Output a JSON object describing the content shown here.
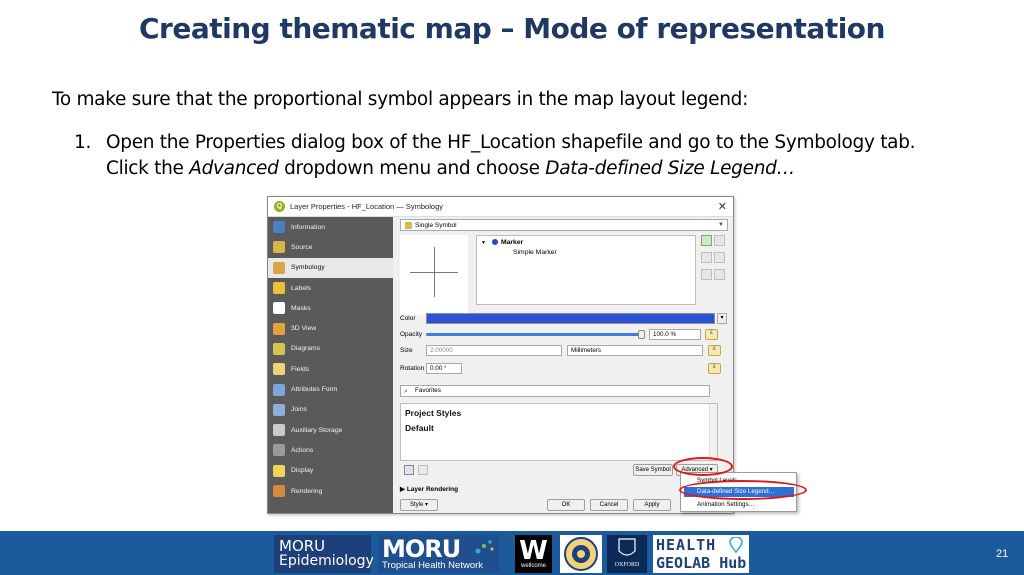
{
  "slide": {
    "title": "Creating thematic map – Mode of representation",
    "intro": "To make sure that the proportional symbol appears in the map layout legend:",
    "step_number": "1.",
    "step_line1": "Open the Properties dialog box of the HF_Location shapefile and go to the Symbology tab.",
    "step_line2_pre": "Click the ",
    "step_line2_em1": "Advanced",
    "step_line2_mid": " dropdown menu and choose ",
    "step_line2_em2": "Data-defined Size Legend…",
    "page_number": "21"
  },
  "dialog": {
    "title": "Layer Properties - HF_Location — Symbology",
    "close": "✕",
    "sidebar": [
      {
        "label": "Information",
        "color": "#4a7fc1",
        "icon": "info-icon"
      },
      {
        "label": "Source",
        "color": "#d8b44a",
        "icon": "source-icon"
      },
      {
        "label": "Symbology",
        "color": "#d9a54a",
        "icon": "paintbrush-icon"
      },
      {
        "label": "Labels",
        "color": "#e9c23a",
        "icon": "labels-icon"
      },
      {
        "label": "Masks",
        "color": "#ffffff",
        "icon": "masks-icon"
      },
      {
        "label": "3D View",
        "color": "#e2a13b",
        "icon": "cube-icon"
      },
      {
        "label": "Diagrams",
        "color": "#d6c24e",
        "icon": "diagrams-icon"
      },
      {
        "label": "Fields",
        "color": "#e8d27a",
        "icon": "fields-icon"
      },
      {
        "label": "Attributes Form",
        "color": "#7fa6d9",
        "icon": "form-icon"
      },
      {
        "label": "Joins",
        "color": "#8ab0d9",
        "icon": "joins-icon"
      },
      {
        "label": "Auxiliary Storage",
        "color": "#cbcbcb",
        "icon": "storage-icon"
      },
      {
        "label": "Actions",
        "color": "#9a9a9a",
        "icon": "gear-icon"
      },
      {
        "label": "Display",
        "color": "#f0d35a",
        "icon": "display-icon"
      },
      {
        "label": "Rendering",
        "color": "#d68a3a",
        "icon": "rendering-icon"
      }
    ],
    "renderer": "Single Symbol",
    "tree_marker": "Marker",
    "tree_simple": "Simple Marker",
    "color_label": "Color",
    "opacity_label": "Opacity",
    "opacity_value": "100.0 %",
    "size_label": "Size",
    "size_value": "2.00000",
    "size_unit": "Millimeters",
    "rotation_label": "Rotation",
    "rotation_value": "0.00 °",
    "favorites": "Favorites",
    "project_styles": "Project Styles",
    "default_style": "Default",
    "save_symbol": "Save Symbol",
    "advanced": "Advanced",
    "layer_rendering": "Layer Rendering",
    "style_btn": "Style",
    "ok": "OK",
    "cancel": "Cancel",
    "apply": "Apply",
    "accent": "#2c52d8"
  },
  "context_menu": {
    "items": [
      "Symbol Levels…",
      "Data-defined Size Legend…",
      "Animation Settings…"
    ],
    "highlight_color": "#2f6fd6",
    "ring_color": "#e01818"
  },
  "footer": {
    "moru_epi_line1": "MORU",
    "moru_epi_line2": "Epidemiology",
    "moru_thn_line1": "MORU",
    "moru_thn_line2": "Tropical Health Network",
    "wellcome_w": "W",
    "wellcome_text": "wellcome",
    "oxford_text": "OXFORD",
    "health_line1": "HEALTH",
    "health_line2": "GEOLAB Hub",
    "band_color": "#1b5a9b"
  }
}
